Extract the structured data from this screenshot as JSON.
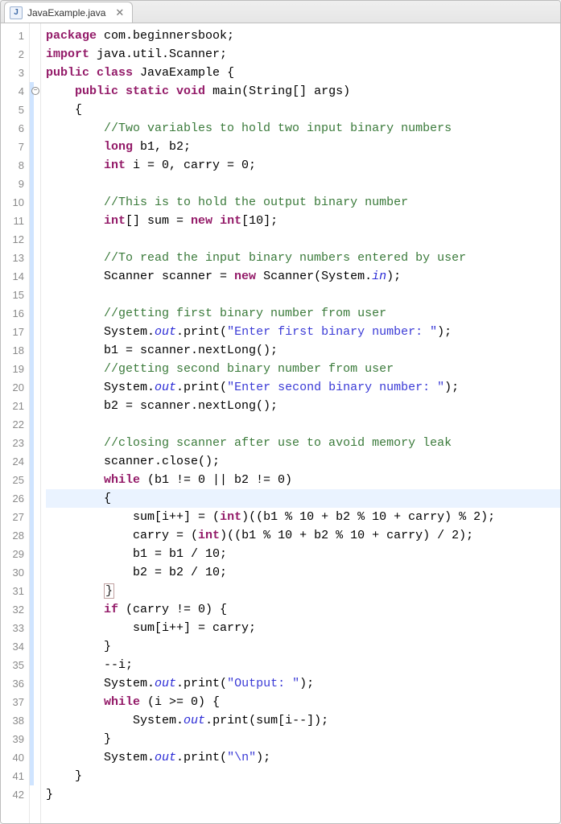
{
  "tab": {
    "filename": "JavaExample.java",
    "icon_letter": "J"
  },
  "editor": {
    "line_count": 42,
    "code_lines": [
      {
        "n": 1,
        "tokens": [
          {
            "t": "package ",
            "c": "kw"
          },
          {
            "t": "com.beginnersbook;",
            "c": "pkg"
          }
        ]
      },
      {
        "n": 2,
        "tokens": [
          {
            "t": "import ",
            "c": "kw"
          },
          {
            "t": "java.util.Scanner;",
            "c": "pkg"
          }
        ]
      },
      {
        "n": 3,
        "tokens": [
          {
            "t": "public class ",
            "c": "kw"
          },
          {
            "t": "JavaExample ",
            "c": "cls"
          },
          {
            "t": "{",
            "c": "punc"
          }
        ]
      },
      {
        "n": 4,
        "indent": 1,
        "fold": true,
        "strip": true,
        "tokens": [
          {
            "t": "public static ",
            "c": "kw"
          },
          {
            "t": "void ",
            "c": "kw2"
          },
          {
            "t": "main(String[] args)",
            "c": "punc"
          }
        ]
      },
      {
        "n": 5,
        "indent": 1,
        "strip": true,
        "tokens": [
          {
            "t": "{",
            "c": "punc"
          }
        ]
      },
      {
        "n": 6,
        "indent": 2,
        "strip": true,
        "tokens": [
          {
            "t": "//Two variables to hold two input binary numbers",
            "c": "com"
          }
        ]
      },
      {
        "n": 7,
        "indent": 2,
        "strip": true,
        "tokens": [
          {
            "t": "long ",
            "c": "kw"
          },
          {
            "t": "b1, b2;",
            "c": "punc"
          }
        ]
      },
      {
        "n": 8,
        "indent": 2,
        "strip": true,
        "tokens": [
          {
            "t": "int ",
            "c": "kw"
          },
          {
            "t": "i = 0, carry = 0;",
            "c": "punc"
          }
        ]
      },
      {
        "n": 9,
        "indent": 2,
        "strip": true,
        "tokens": []
      },
      {
        "n": 10,
        "indent": 2,
        "strip": true,
        "tokens": [
          {
            "t": "//This is to hold the output binary number",
            "c": "com"
          }
        ]
      },
      {
        "n": 11,
        "indent": 2,
        "strip": true,
        "tokens": [
          {
            "t": "int",
            "c": "kw"
          },
          {
            "t": "[] sum = ",
            "c": "punc"
          },
          {
            "t": "new ",
            "c": "kw"
          },
          {
            "t": "int",
            "c": "kw"
          },
          {
            "t": "[10];",
            "c": "punc"
          }
        ]
      },
      {
        "n": 12,
        "indent": 2,
        "strip": true,
        "tokens": []
      },
      {
        "n": 13,
        "indent": 2,
        "strip": true,
        "tokens": [
          {
            "t": "//To read the input binary numbers entered by user",
            "c": "com"
          }
        ]
      },
      {
        "n": 14,
        "indent": 2,
        "strip": true,
        "tokens": [
          {
            "t": "Scanner scanner = ",
            "c": "punc"
          },
          {
            "t": "new ",
            "c": "kw"
          },
          {
            "t": "Scanner(System.",
            "c": "punc"
          },
          {
            "t": "in",
            "c": "stat"
          },
          {
            "t": ");",
            "c": "punc"
          }
        ]
      },
      {
        "n": 15,
        "indent": 2,
        "strip": true,
        "tokens": []
      },
      {
        "n": 16,
        "indent": 2,
        "strip": true,
        "tokens": [
          {
            "t": "//getting first binary number from user",
            "c": "com"
          }
        ]
      },
      {
        "n": 17,
        "indent": 2,
        "strip": true,
        "tokens": [
          {
            "t": "System.",
            "c": "punc"
          },
          {
            "t": "out",
            "c": "stat"
          },
          {
            "t": ".print(",
            "c": "punc"
          },
          {
            "t": "\"Enter first binary number: \"",
            "c": "str"
          },
          {
            "t": ");",
            "c": "punc"
          }
        ]
      },
      {
        "n": 18,
        "indent": 2,
        "strip": true,
        "tokens": [
          {
            "t": "b1 = scanner.nextLong();",
            "c": "punc"
          }
        ]
      },
      {
        "n": 19,
        "indent": 2,
        "strip": true,
        "tokens": [
          {
            "t": "//getting second binary number from user",
            "c": "com"
          }
        ]
      },
      {
        "n": 20,
        "indent": 2,
        "strip": true,
        "tokens": [
          {
            "t": "System.",
            "c": "punc"
          },
          {
            "t": "out",
            "c": "stat"
          },
          {
            "t": ".print(",
            "c": "punc"
          },
          {
            "t": "\"Enter second binary number: \"",
            "c": "str"
          },
          {
            "t": ");",
            "c": "punc"
          }
        ]
      },
      {
        "n": 21,
        "indent": 2,
        "strip": true,
        "tokens": [
          {
            "t": "b2 = scanner.nextLong();",
            "c": "punc"
          }
        ]
      },
      {
        "n": 22,
        "indent": 2,
        "strip": true,
        "tokens": []
      },
      {
        "n": 23,
        "indent": 2,
        "strip": true,
        "tokens": [
          {
            "t": "//closing scanner after use to avoid memory leak",
            "c": "com"
          }
        ]
      },
      {
        "n": 24,
        "indent": 2,
        "strip": true,
        "tokens": [
          {
            "t": "scanner.close();",
            "c": "punc"
          }
        ]
      },
      {
        "n": 25,
        "indent": 2,
        "strip": true,
        "tokens": [
          {
            "t": "while ",
            "c": "kw"
          },
          {
            "t": "(b1 != 0 || b2 != 0)",
            "c": "punc"
          }
        ]
      },
      {
        "n": 26,
        "indent": 2,
        "strip": true,
        "hl": true,
        "tokens": [
          {
            "t": "{",
            "c": "punc"
          }
        ]
      },
      {
        "n": 27,
        "indent": 3,
        "strip": true,
        "tokens": [
          {
            "t": "sum[i++] = (",
            "c": "punc"
          },
          {
            "t": "int",
            "c": "kw"
          },
          {
            "t": ")((b1 % 10 + b2 % 10 + carry) % 2);",
            "c": "punc"
          }
        ]
      },
      {
        "n": 28,
        "indent": 3,
        "strip": true,
        "tokens": [
          {
            "t": "carry = (",
            "c": "punc"
          },
          {
            "t": "int",
            "c": "kw"
          },
          {
            "t": ")((b1 % 10 + b2 % 10 + carry) / 2);",
            "c": "punc"
          }
        ]
      },
      {
        "n": 29,
        "indent": 3,
        "strip": true,
        "tokens": [
          {
            "t": "b1 = b1 / 10;",
            "c": "punc"
          }
        ]
      },
      {
        "n": 30,
        "indent": 3,
        "strip": true,
        "tokens": [
          {
            "t": "b2 = b2 / 10;",
            "c": "punc"
          }
        ]
      },
      {
        "n": 31,
        "indent": 2,
        "strip": true,
        "tokens": [
          {
            "t": "}",
            "c": "boxb"
          }
        ]
      },
      {
        "n": 32,
        "indent": 2,
        "strip": true,
        "tokens": [
          {
            "t": "if ",
            "c": "kw"
          },
          {
            "t": "(carry != 0) {",
            "c": "punc"
          }
        ]
      },
      {
        "n": 33,
        "indent": 3,
        "strip": true,
        "tokens": [
          {
            "t": "sum[i++] = carry;",
            "c": "punc"
          }
        ]
      },
      {
        "n": 34,
        "indent": 2,
        "strip": true,
        "tokens": [
          {
            "t": "}",
            "c": "punc"
          }
        ]
      },
      {
        "n": 35,
        "indent": 2,
        "strip": true,
        "tokens": [
          {
            "t": "--i;",
            "c": "punc"
          }
        ]
      },
      {
        "n": 36,
        "indent": 2,
        "strip": true,
        "tokens": [
          {
            "t": "System.",
            "c": "punc"
          },
          {
            "t": "out",
            "c": "stat"
          },
          {
            "t": ".print(",
            "c": "punc"
          },
          {
            "t": "\"Output: \"",
            "c": "str"
          },
          {
            "t": ");",
            "c": "punc"
          }
        ]
      },
      {
        "n": 37,
        "indent": 2,
        "strip": true,
        "tokens": [
          {
            "t": "while ",
            "c": "kw"
          },
          {
            "t": "(i >= 0) {",
            "c": "punc"
          }
        ]
      },
      {
        "n": 38,
        "indent": 3,
        "strip": true,
        "tokens": [
          {
            "t": "System.",
            "c": "punc"
          },
          {
            "t": "out",
            "c": "stat"
          },
          {
            "t": ".print(sum[i--]);",
            "c": "punc"
          }
        ]
      },
      {
        "n": 39,
        "indent": 2,
        "strip": true,
        "tokens": [
          {
            "t": "}",
            "c": "punc"
          }
        ]
      },
      {
        "n": 40,
        "indent": 2,
        "strip": true,
        "tokens": [
          {
            "t": "System.",
            "c": "punc"
          },
          {
            "t": "out",
            "c": "stat"
          },
          {
            "t": ".print(",
            "c": "punc"
          },
          {
            "t": "\"\\n\"",
            "c": "str"
          },
          {
            "t": ");",
            "c": "punc"
          }
        ]
      },
      {
        "n": 41,
        "indent": 1,
        "strip": true,
        "tokens": [
          {
            "t": "}",
            "c": "punc"
          }
        ]
      },
      {
        "n": 42,
        "indent": 0,
        "tokens": [
          {
            "t": "}",
            "c": "punc"
          }
        ]
      }
    ]
  }
}
